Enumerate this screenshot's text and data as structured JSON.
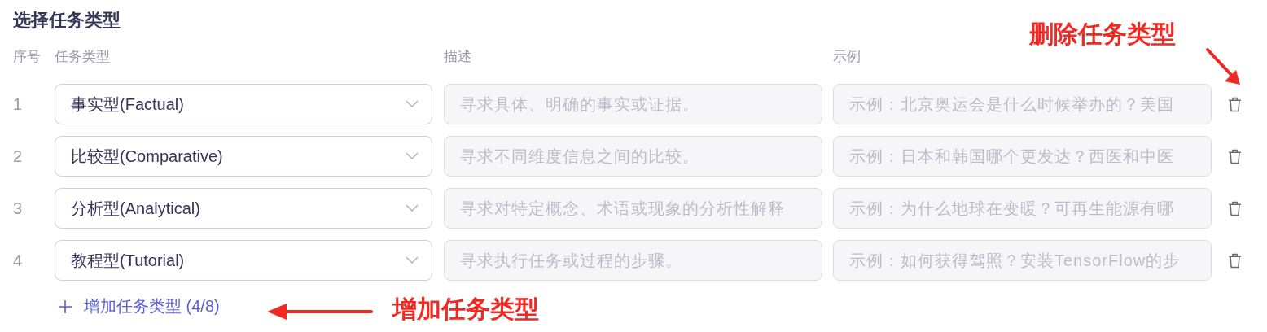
{
  "title": "选择任务类型",
  "columns": [
    "序号",
    "任务类型",
    "描述",
    "示例"
  ],
  "rows": [
    {
      "index": "1",
      "type": "事实型(Factual)",
      "description": {
        "placeholder": "寻求具体、明确的事实或证据。"
      },
      "example": {
        "placeholder": "示例：北京奥运会是什么时候举办的？美国"
      }
    },
    {
      "index": "2",
      "type": "比较型(Comparative)",
      "description": {
        "placeholder": "寻求不同维度信息之间的比较。"
      },
      "example": {
        "placeholder": "示例：日本和韩国哪个更发达？西医和中医"
      }
    },
    {
      "index": "3",
      "type": "分析型(Analytical)",
      "description": {
        "placeholder": "寻求对特定概念、术语或现象的分析性解释"
      },
      "example": {
        "placeholder": "示例：为什么地球在变暖？可再生能源有哪"
      }
    },
    {
      "index": "4",
      "type": "教程型(Tutorial)",
      "description": {
        "placeholder": "寻求执行任务或过程的步骤。"
      },
      "example": {
        "placeholder": "示例：如何获得驾照？安装TensorFlow的步"
      }
    }
  ],
  "add_button": {
    "label": "增加任务类型 (4/8)"
  },
  "annotations": [
    {
      "kind": "delete",
      "text": "删除任务类型"
    },
    {
      "kind": "add",
      "text": "增加任务类型"
    }
  ]
}
